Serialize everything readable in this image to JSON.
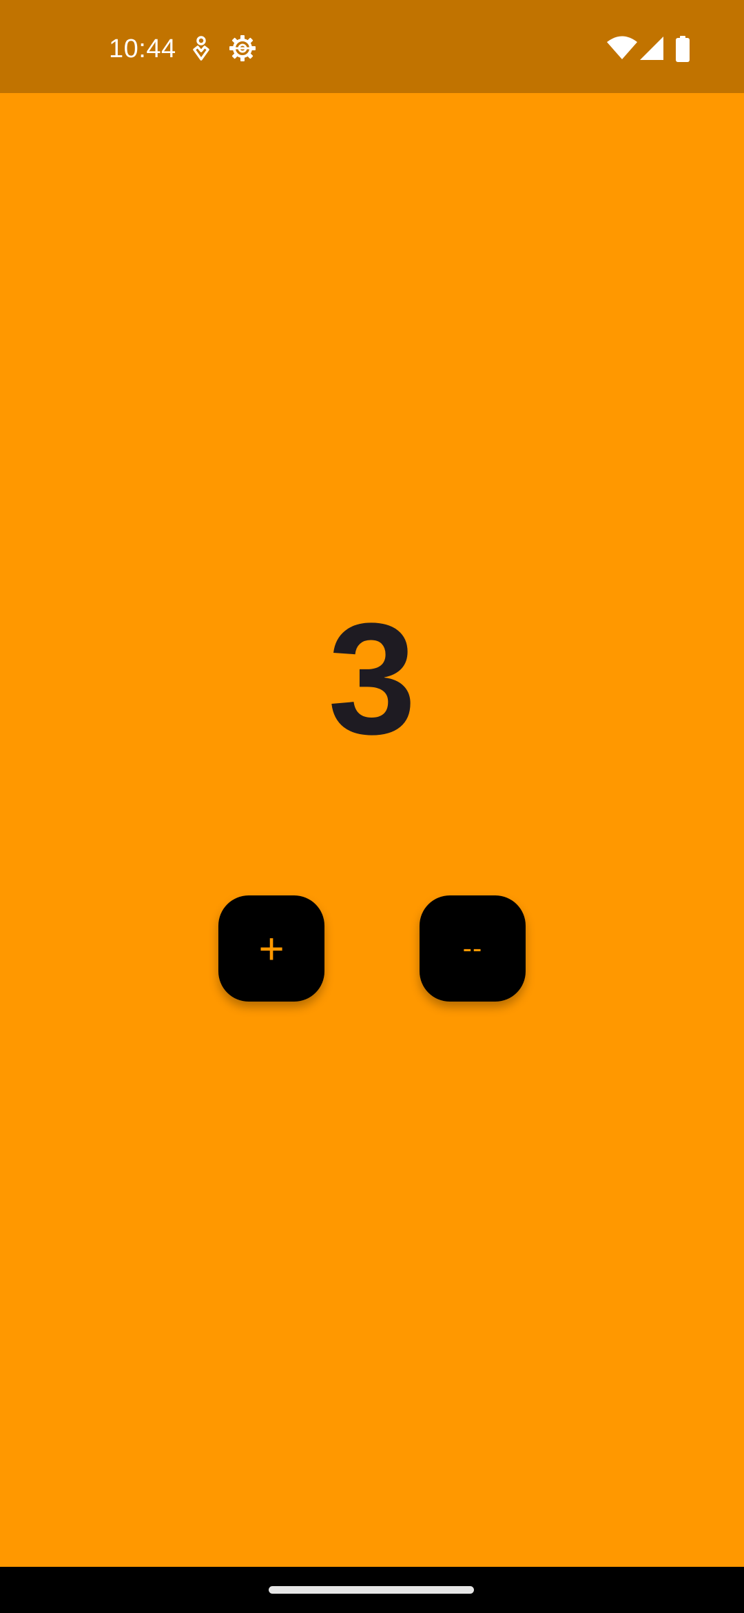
{
  "status_bar": {
    "time": "10:44",
    "icons": [
      "notification-icon",
      "settings-gear-icon",
      "wifi-icon",
      "cellular-signal-icon",
      "battery-icon"
    ]
  },
  "counter": {
    "value": "3"
  },
  "buttons": {
    "increment_label": "+",
    "decrement_label": "--"
  },
  "colors": {
    "background": "#FF9800",
    "status_bar": "#C17300",
    "counter_text": "#1E1B22",
    "button_bg": "#000000",
    "button_text": "#FF9800"
  }
}
